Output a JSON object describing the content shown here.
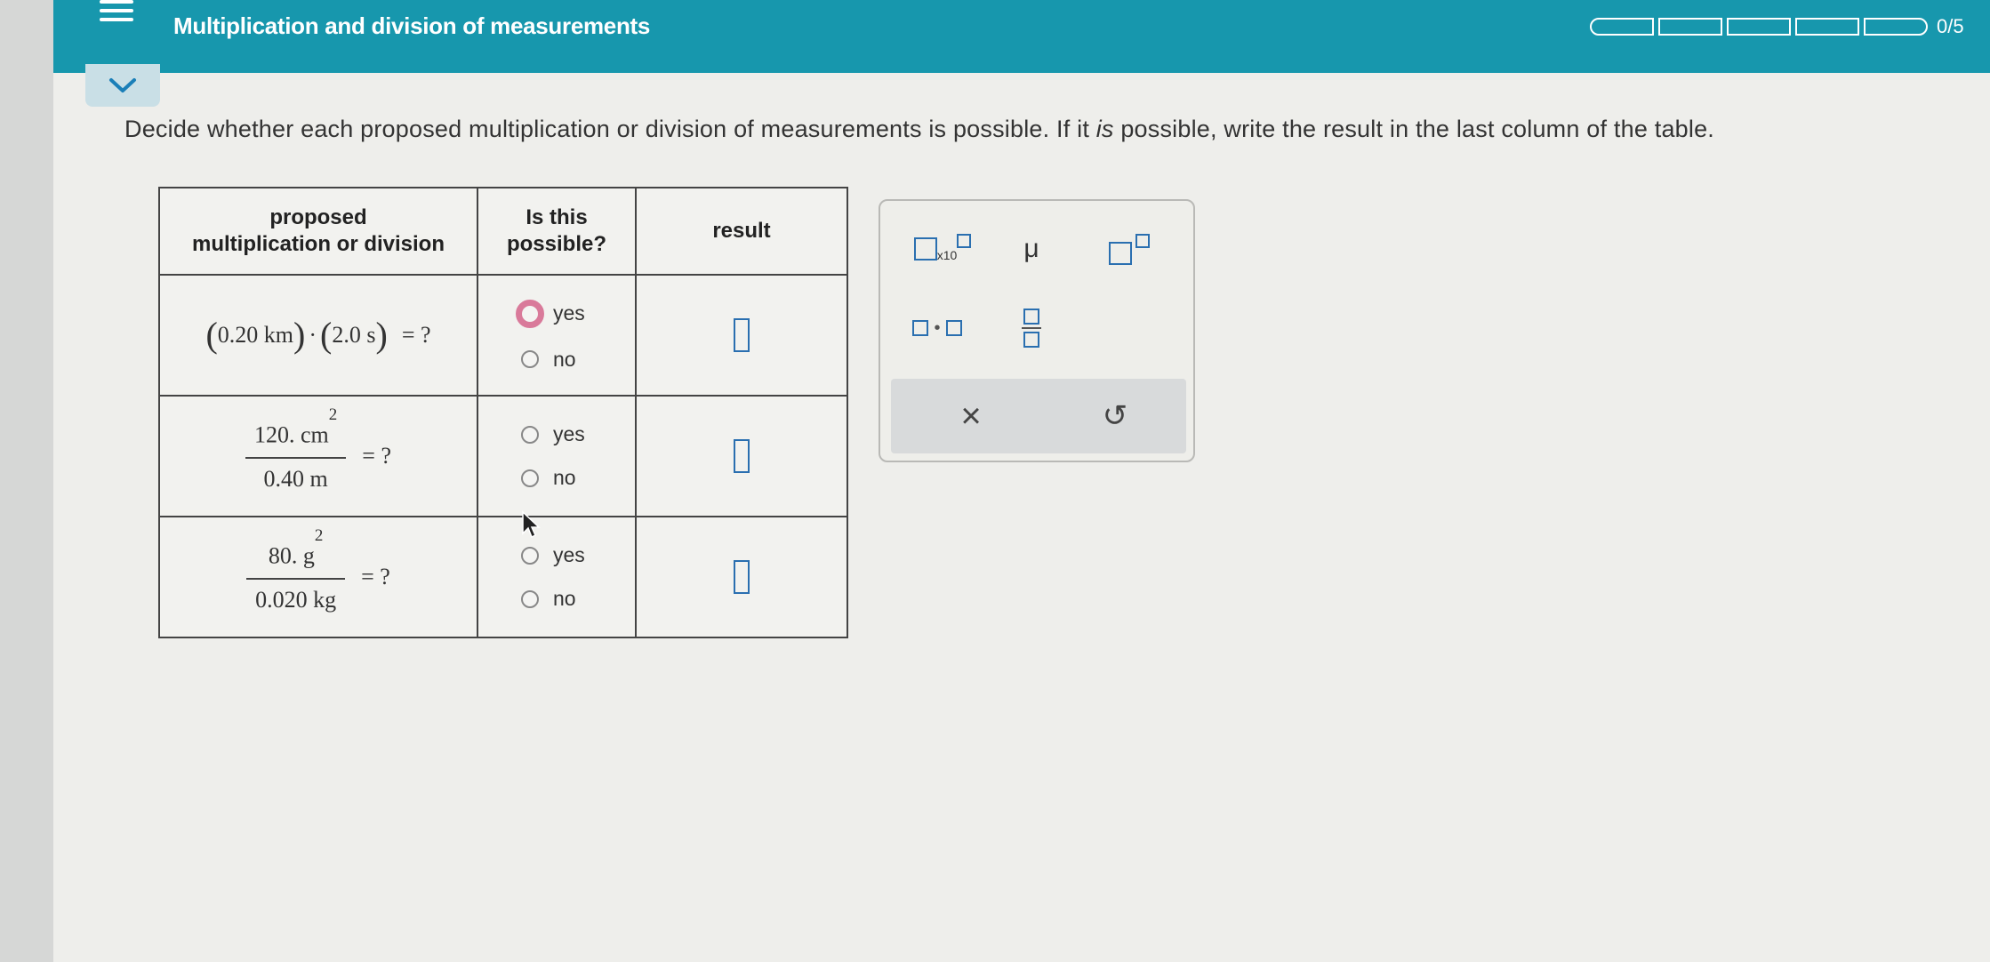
{
  "header": {
    "title": "Multiplication and division of measurements",
    "progress": "0/5",
    "segments": 5
  },
  "prompt": {
    "part1": "Decide whether each proposed multiplication or division of measurements is possible. If it ",
    "emph": "is",
    "part2": " possible, write the result in the last column of the table."
  },
  "table": {
    "headers": {
      "col1_line1": "proposed",
      "col1_line2": "multiplication or division",
      "col2_line1": "Is this",
      "col2_line2": "possible?",
      "col3": "result"
    },
    "rows": [
      {
        "left_num": "0.20 km",
        "dot": "·",
        "right_num": "2.0 s",
        "eq": "= ?",
        "yes": "yes",
        "no": "no"
      },
      {
        "num": "120. cm",
        "num_exp": "2",
        "den": "0.40 m",
        "eq": "= ?",
        "yes": "yes",
        "no": "no"
      },
      {
        "num": "80. g",
        "num_exp": "2",
        "den": "0.020 kg",
        "eq": "= ?",
        "yes": "yes",
        "no": "no"
      }
    ]
  },
  "palette": {
    "sci_label": "x10",
    "mu": "μ",
    "clear": "×",
    "undo": "↺"
  }
}
